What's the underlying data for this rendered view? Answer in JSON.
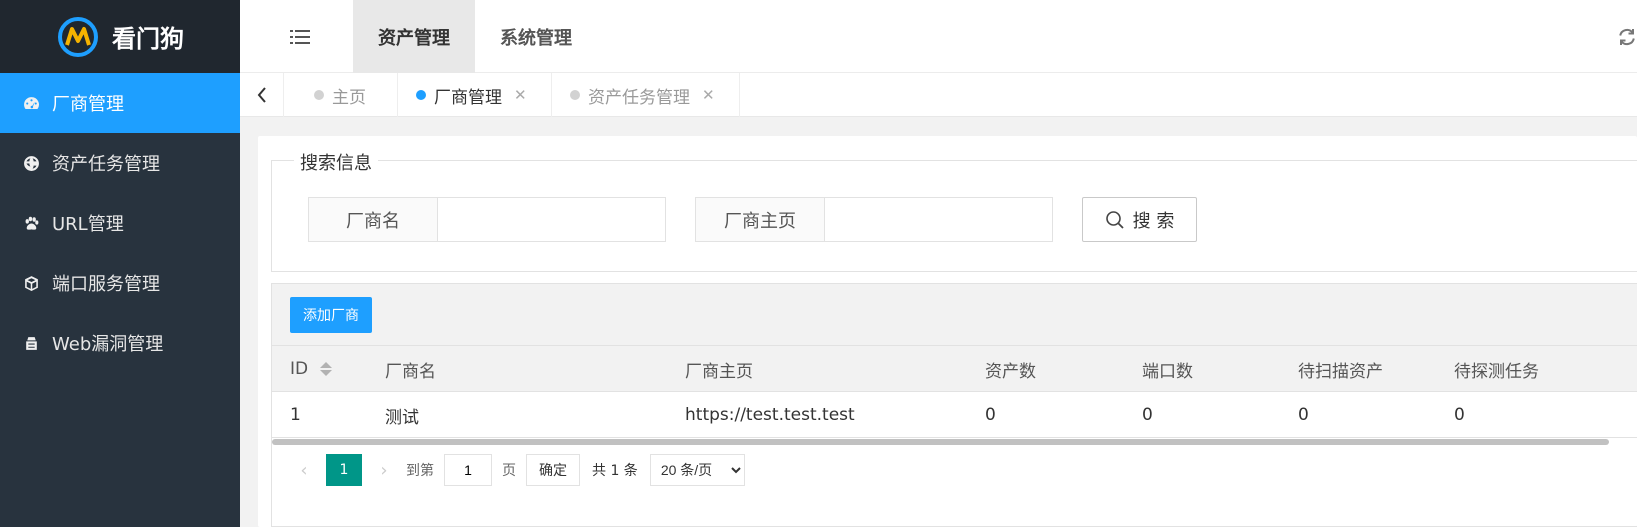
{
  "app": {
    "name": "看门狗"
  },
  "sidebar": {
    "items": [
      {
        "label": "厂商管理",
        "icon": "dashboard-icon",
        "active": true
      },
      {
        "label": "资产任务管理",
        "icon": "globe-icon",
        "active": false
      },
      {
        "label": "URL管理",
        "icon": "paw-icon",
        "active": false
      },
      {
        "label": "端口服务管理",
        "icon": "cube-icon",
        "active": false
      },
      {
        "label": "Web漏洞管理",
        "icon": "bug-icon",
        "active": false
      }
    ]
  },
  "header": {
    "tabs": [
      {
        "label": "资产管理",
        "active": true
      },
      {
        "label": "系统管理",
        "active": false
      }
    ]
  },
  "page_tabs": [
    {
      "label": "主页",
      "active": false,
      "closable": false
    },
    {
      "label": "厂商管理",
      "active": true,
      "closable": true
    },
    {
      "label": "资产任务管理",
      "active": false,
      "closable": true
    }
  ],
  "search": {
    "legend": "搜索信息",
    "vendor_name_label": "厂商名",
    "vendor_name_value": "",
    "vendor_home_label": "厂商主页",
    "vendor_home_value": "",
    "button_label": "搜 索"
  },
  "toolbar": {
    "add_label": "添加厂商"
  },
  "table": {
    "columns": [
      "ID",
      "厂商名",
      "厂商主页",
      "资产数",
      "端口数",
      "待扫描资产",
      "待探测任务"
    ],
    "rows": [
      [
        "1",
        "测试",
        "https://test.test.test",
        "0",
        "0",
        "0",
        "0"
      ]
    ]
  },
  "pagination": {
    "current_page": "1",
    "goto_label": "到第",
    "goto_value": "1",
    "page_suffix": "页",
    "confirm_label": "确定",
    "total_label": "共 1 条",
    "page_size_options": [
      "20 条/页"
    ],
    "page_size_selected": "20 条/页"
  },
  "colors": {
    "sidebar_bg": "#28333e",
    "logo_bg": "#20272f",
    "accent": "#1e9fff",
    "pager_active": "#009688"
  }
}
